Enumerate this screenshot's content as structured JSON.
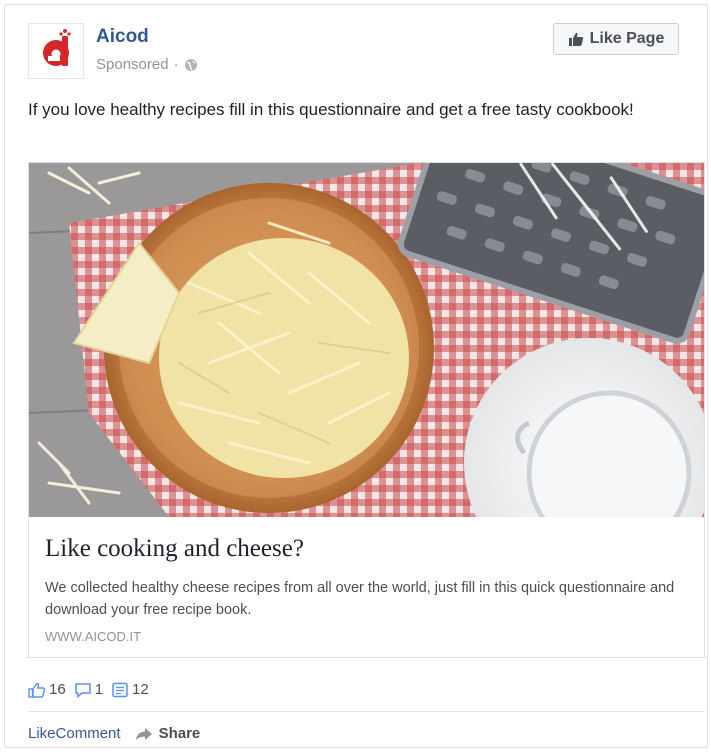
{
  "post": {
    "page_name": "Aicod",
    "sponsored_label": "Sponsored",
    "sponsored_separator": "·",
    "like_page_button": "Like Page",
    "text": "If you love healthy recipes fill in this questionnaire and get a free tasty cookbook!"
  },
  "link_card": {
    "image_icon": "cheese-photo",
    "title": "Like cooking and cheese?",
    "description": "We collected healthy cheese recipes from all over the world, just fill in this quick questionnaire and download your free recipe book.",
    "url": "WWW.AICOD.IT"
  },
  "counts": {
    "likes": "16",
    "comments": "1",
    "shares": "12"
  },
  "actions": {
    "like": "Like",
    "comment": "Comment",
    "share": "Share"
  },
  "colors": {
    "link_blue": "#365899",
    "brand_red": "#d7262c",
    "muted_gray": "#90949c"
  }
}
